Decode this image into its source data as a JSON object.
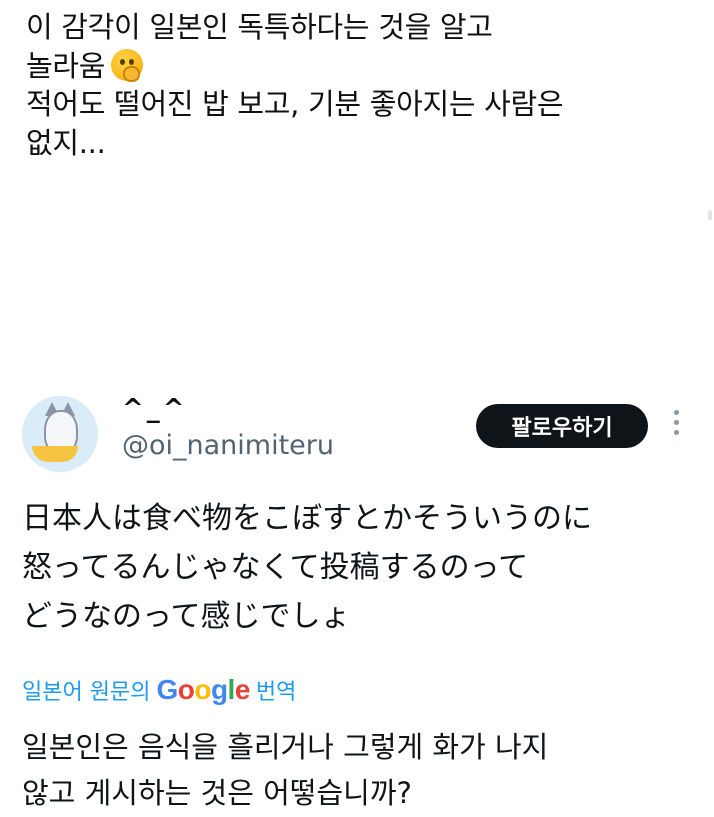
{
  "comment": {
    "lines": [
      "이 감각이 일본인 독특하다는 것을 알고",
      "놀라움",
      "적어도 떨어진 밥 보고, 기분 좋아지는 사람은",
      "없지..."
    ],
    "emoji": "shushing-face-icon"
  },
  "tweet": {
    "display_name": "^_^",
    "handle": "@oi_nanimiteru",
    "follow_label": "팔로우하기",
    "original_lines": [
      "日本人は食べ物をこぼすとかそういうのに",
      "怒ってるんじゃなくて投稿するのって",
      "どうなのって感じでしょ"
    ],
    "translate": {
      "prefix": "일본어 원문의",
      "google": [
        "G",
        "o",
        "o",
        "g",
        "l",
        "e"
      ],
      "suffix": "번역",
      "google_colors": [
        "#4285F4",
        "#EA4335",
        "#FBBC05",
        "#4285F4",
        "#34A853",
        "#EA4335"
      ]
    },
    "translated_lines": [
      "일본인은 음식을 흘리거나 그렇게 화가 나지",
      "않고 게시하는 것은 어떻습니까?"
    ]
  }
}
